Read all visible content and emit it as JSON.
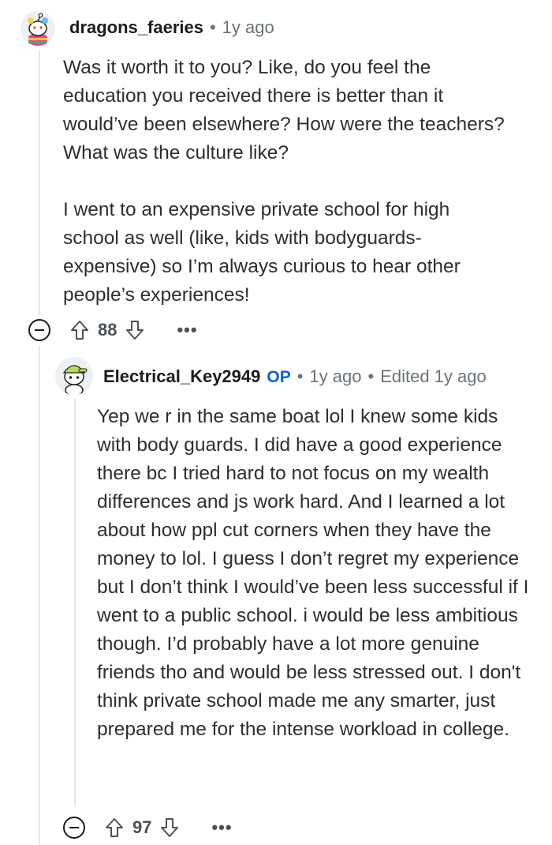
{
  "comments": [
    {
      "username": "dragons_faeries",
      "time": "1y ago",
      "paragraphs": [
        "Was it worth it to you? Like, do you feel the education you received there is better than it would’ve been elsewhere? How were the teachers? What was the culture like?",
        "I went to an expensive private school for high school as well (like, kids with bodyguards-expensive) so I’m always curious to hear other people’s experiences!"
      ],
      "score": "88",
      "avatar_icon": "snoo-avatar-icon"
    },
    {
      "username": "Electrical_Key2949",
      "op_badge": "OP",
      "time": "1y ago",
      "edited": "Edited 1y ago",
      "paragraphs": [
        "Yep we r in the same boat lol I knew some kids with body guards. I did have a good experience there bc I tried hard to not focus on my wealth differences and js work hard. And I learned a lot about how ppl cut corners when they have the money to lol. I guess I don’t regret my experience but I don’t think I would’ve been less successful if I went to a public school. i would be less ambitious though. I’d probably have a lot more genuine friends tho and would be less stressed out. I don't think private school made me any smarter, just prepared me for the intense workload in college."
      ],
      "score": "97",
      "avatar_icon": "snoo-avatar-icon"
    }
  ],
  "icons": {
    "collapse": "collapse-icon",
    "upvote": "upvote-icon",
    "downvote": "downvote-icon",
    "more": "more-options-icon"
  },
  "colors": {
    "op_badge": "#0a63d6",
    "meta": "#6a7379",
    "thread_line": "#e4e6e8"
  }
}
